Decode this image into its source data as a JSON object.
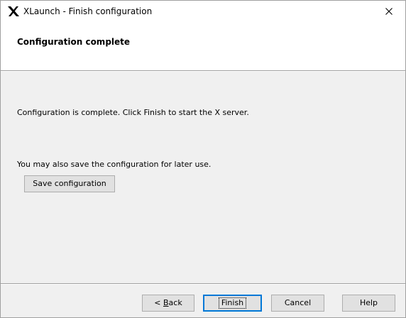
{
  "window": {
    "title": "XLaunch - Finish configuration",
    "close_symbol": "×"
  },
  "header": {
    "title": "Configuration complete"
  },
  "content": {
    "complete_message": "Configuration is complete. Click Finish to start the X server.",
    "save_message": "You may also save the configuration for later use.",
    "save_button_label": "Save configuration"
  },
  "footer": {
    "back_prefix": "< ",
    "back_mnemonic": "B",
    "back_rest": "ack",
    "finish_label": "Finish",
    "cancel_label": "Cancel",
    "help_label": "Help"
  },
  "icons": {
    "app": "x-logo-icon",
    "close": "close-icon"
  },
  "colors": {
    "window_bg": "#f0f0f0",
    "header_bg": "#ffffff",
    "button_bg": "#e1e1e1",
    "button_border": "#adadad",
    "default_button_border": "#0078d7"
  }
}
